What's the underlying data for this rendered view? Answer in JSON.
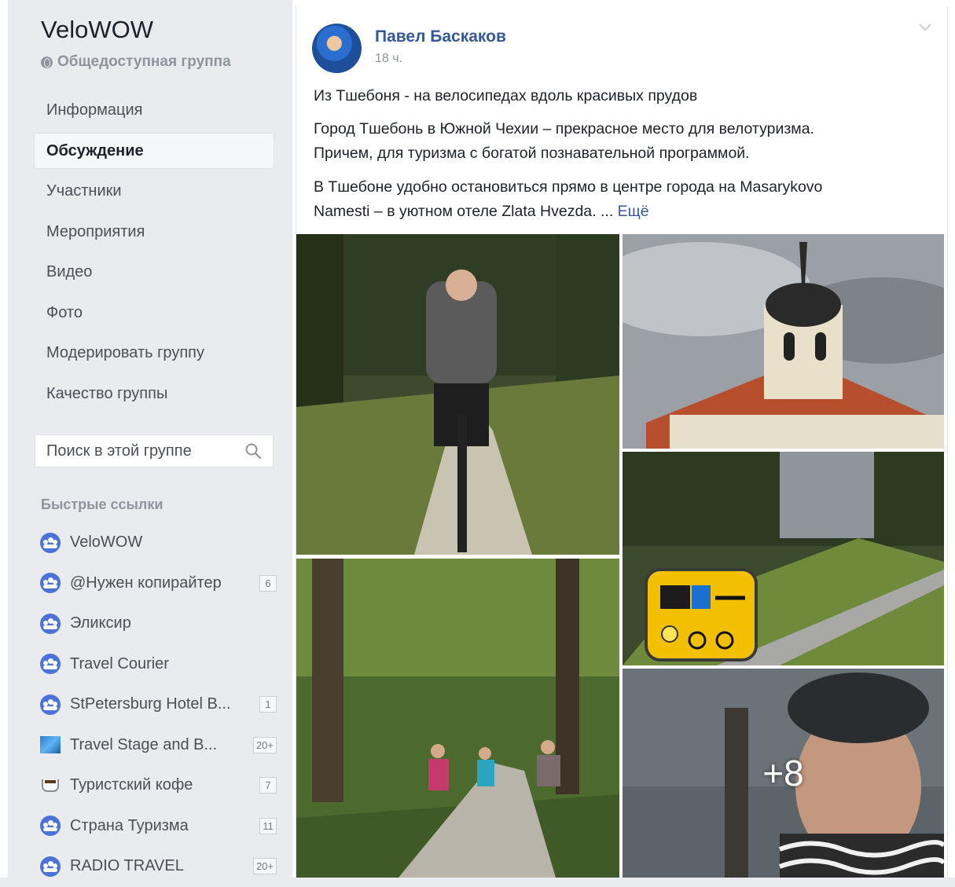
{
  "group": {
    "title": "VeloWOW",
    "privacy": "Общедоступная группа"
  },
  "nav": [
    {
      "label": "Информация",
      "active": false
    },
    {
      "label": "Обсуждение",
      "active": true
    },
    {
      "label": "Участники",
      "active": false
    },
    {
      "label": "Мероприятия",
      "active": false
    },
    {
      "label": "Видео",
      "active": false
    },
    {
      "label": "Фото",
      "active": false
    },
    {
      "label": "Модерировать группу",
      "active": false
    },
    {
      "label": "Качество группы",
      "active": false
    }
  ],
  "search": {
    "placeholder": "Поиск в этой группе"
  },
  "quick_links": {
    "title": "Быстрые ссылки",
    "items": [
      {
        "label": "VeloWOW",
        "badge": "",
        "icon": "group-icon"
      },
      {
        "label": "@Нужен копирайтер",
        "badge": "6",
        "icon": "group-icon"
      },
      {
        "label": "Эликсир",
        "badge": "",
        "icon": "group-icon"
      },
      {
        "label": "Travel Courier",
        "badge": "",
        "icon": "group-icon"
      },
      {
        "label": "StPetersburg Hotel B...",
        "badge": "1",
        "icon": "group-icon"
      },
      {
        "label": "Travel Stage and B...",
        "badge": "20+",
        "icon": "group-thumb-icon"
      },
      {
        "label": "Туристский кофе",
        "badge": "7",
        "icon": "coffee-cup-icon"
      },
      {
        "label": "Страна Туризма",
        "badge": "11",
        "icon": "group-icon"
      },
      {
        "label": "RADIO TRAVEL",
        "badge": "20+",
        "icon": "group-icon"
      }
    ]
  },
  "post": {
    "author": "Павел Баскаков",
    "time": "18 ч.",
    "title": "Из Тшебоня - на велосипедах вдоль красивых прудов",
    "paragraph1_line1": "Город Тшебонь в Южной Чехии – прекрасное место для велотуризма.",
    "paragraph1_line2": "Причем, для туризма с богатой познавательной программой.",
    "paragraph2_line1": "В Тшебоне удобно остановиться прямо в центре города на Masarykovo",
    "paragraph2_line2": "Namesti – в уютном отеле Zlata Hvezda. ...",
    "more_link": "Ещё",
    "more_photos": "+8"
  }
}
